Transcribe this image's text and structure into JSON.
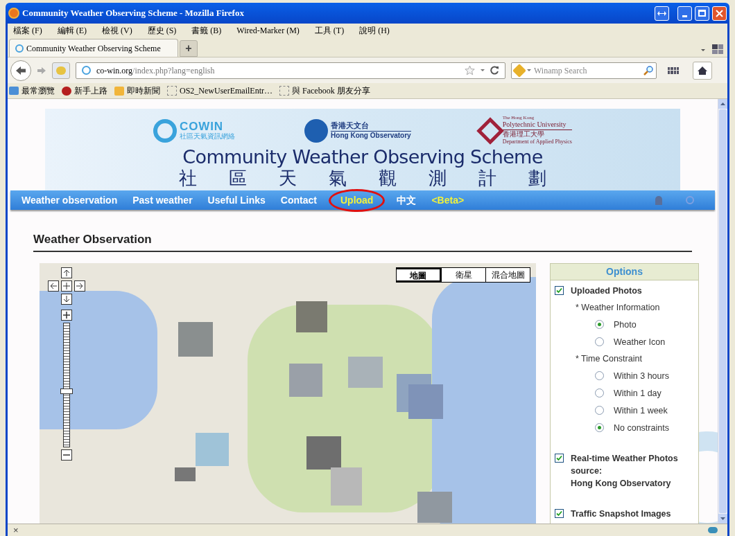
{
  "window": {
    "title": "Community Weather Observing Scheme - Mozilla Firefox"
  },
  "menu": [
    "檔案 (F)",
    "編輯 (E)",
    "檢視 (V)",
    "歷史 (S)",
    "書籤 (B)",
    "Wired-Marker (M)",
    "工具 (T)",
    "說明 (H)"
  ],
  "tabs": [
    {
      "label": "Community Weather Observing Scheme",
      "selected": true
    }
  ],
  "new_tab": "+",
  "address": {
    "domain": "co-win.org",
    "path": "/index.php?lang=english"
  },
  "search": {
    "placeholder": "Winamp Search"
  },
  "bookmarks": [
    {
      "label": "最常瀏覽",
      "kind": "folder"
    },
    {
      "label": "新手上路",
      "kind": "guide"
    },
    {
      "label": "即時新聞",
      "kind": "feed"
    },
    {
      "label": "OS2_NewUserEmailEntr…",
      "kind": "page"
    },
    {
      "label": "與 Facebook 朋友分享",
      "kind": "page"
    }
  ],
  "banner": {
    "cowin": "COWIN",
    "cowin_sub": "社區天氣資訊網絡",
    "hko_cn": "香港天文台",
    "hko_en": "Hong Kong Observatory",
    "polyu_small": "The Hong Kong",
    "polyu": "Polytechnic University",
    "polyu_cn": "香港理工大學",
    "polyu_dept": "Department of Applied Physics",
    "title": "Community Weather Observing Scheme",
    "title_cn": [
      "社",
      "區",
      "天",
      "氣",
      "觀",
      "測",
      "計",
      "劃"
    ]
  },
  "nav": [
    {
      "label": "Weather observation",
      "kind": "link",
      "circled": false
    },
    {
      "label": "Past weather",
      "kind": "link",
      "circled": false
    },
    {
      "label": "Useful Links",
      "kind": "link",
      "circled": false
    },
    {
      "label": "Contact",
      "kind": "link",
      "circled": false
    },
    {
      "label": "Upload",
      "kind": "highlight",
      "circled": true
    },
    {
      "label": "中文",
      "kind": "link",
      "circled": false
    },
    {
      "label": "<Beta>",
      "kind": "highlight",
      "circled": false
    }
  ],
  "heading": "Weather Observation",
  "map": {
    "types": [
      {
        "label": "地圖",
        "selected": true
      },
      {
        "label": "衛星",
        "selected": false
      },
      {
        "label": "混合地圖",
        "selected": false
      }
    ],
    "zoom": {
      "level": 0.45
    }
  },
  "options": {
    "title": "Options",
    "items": [
      {
        "kind": "check",
        "label": "Uploaded Photos",
        "checked": true
      },
      {
        "kind": "section",
        "label": "* Weather Information"
      },
      {
        "kind": "radio",
        "label": "Photo",
        "selected": true
      },
      {
        "kind": "radio",
        "label": "Weather Icon",
        "selected": false
      },
      {
        "kind": "section",
        "label": "* Time Constraint"
      },
      {
        "kind": "radio",
        "label": "Within 3 hours",
        "selected": false
      },
      {
        "kind": "radio",
        "label": "Within 1 day",
        "selected": false
      },
      {
        "kind": "radio",
        "label": "Within 1 week",
        "selected": false
      },
      {
        "kind": "radio",
        "label": "No constraints",
        "selected": true
      },
      {
        "kind": "check",
        "label": "Real-time Weather Photos source:\nHong Kong Observatory",
        "checked": true
      },
      {
        "kind": "check",
        "label": "Traffic Snapshot Images",
        "checked": true
      }
    ]
  },
  "status_bar": {
    "close": "×"
  }
}
